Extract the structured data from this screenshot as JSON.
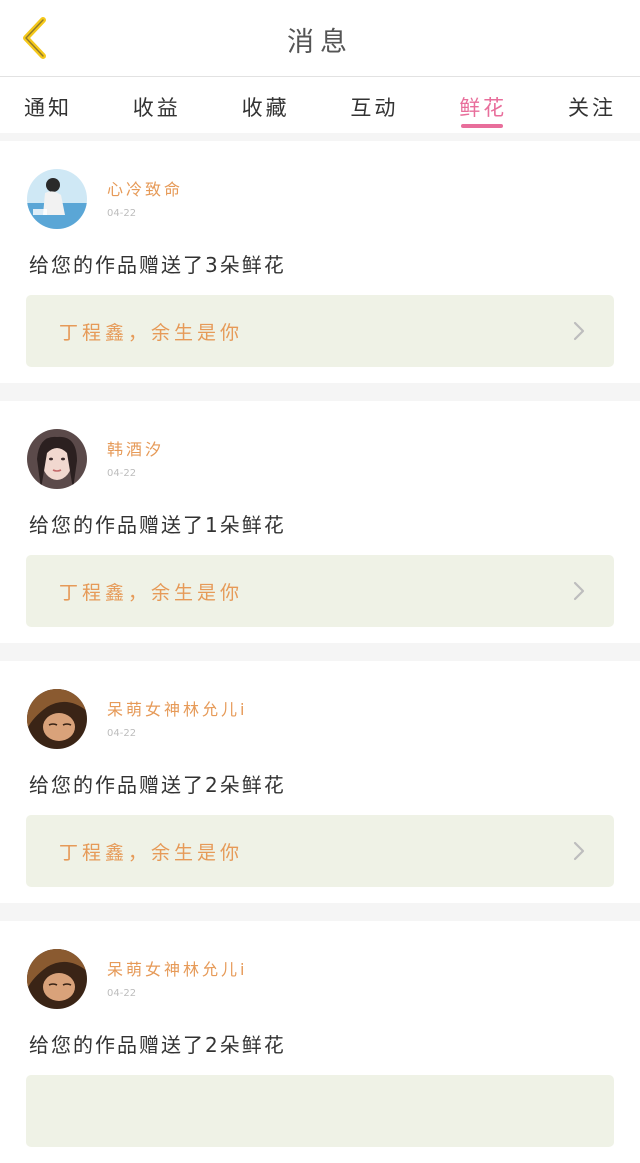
{
  "header": {
    "title": "消息",
    "back_icon": "chevron-left-icon",
    "back_color": "#f5c81a"
  },
  "tabs": [
    {
      "label": "通知"
    },
    {
      "label": "收益"
    },
    {
      "label": "收藏"
    },
    {
      "label": "互动"
    },
    {
      "label": "鲜花",
      "active": true
    },
    {
      "label": "关注"
    }
  ],
  "accent_color": "#e86e9b",
  "messages": [
    {
      "username": "心冷致命",
      "date": "04-22",
      "text": "给您的作品赠送了3朵鲜花",
      "work_title": "丁程鑫，余生是你"
    },
    {
      "username": "韩酒汐",
      "date": "04-22",
      "text": "给您的作品赠送了1朵鲜花",
      "work_title": "丁程鑫，余生是你"
    },
    {
      "username": "呆萌女神林允儿i",
      "date": "04-22",
      "text": "给您的作品赠送了2朵鲜花",
      "work_title": "丁程鑫，余生是你"
    },
    {
      "username": "呆萌女神林允儿i",
      "date": "04-22",
      "text": "给您的作品赠送了2朵鲜花",
      "work_title": ""
    }
  ]
}
